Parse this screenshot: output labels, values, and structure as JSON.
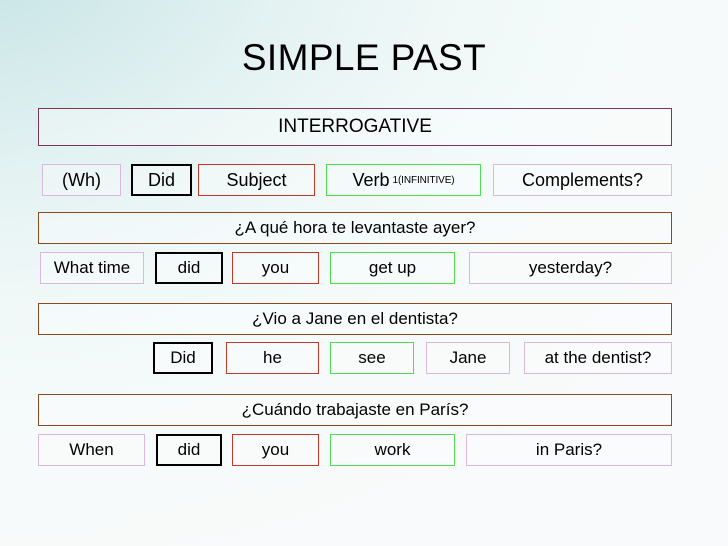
{
  "slide": {
    "title": "SIMPLE PAST",
    "section_label": "INTERROGATIVE",
    "background_accent": "#bfe0e2"
  },
  "colors": {
    "section_border": "#7a3558",
    "sentence_border": "#8a4a20",
    "wh_border": "#d9b8dd",
    "aux_border": "#000000",
    "subject_border": "#c0392b",
    "verb_border": "#4fdc4f",
    "complement_border": "#d9b8dd"
  },
  "headers": {
    "wh": "(Wh)",
    "aux": "Did",
    "subject": "Subject",
    "verb": "Verb",
    "verb_sub": "1(INFINITIVE)",
    "complements": "Complements?"
  },
  "examples": [
    {
      "spanish": "¿A qué hora te levantaste ayer?",
      "wh": "What time",
      "aux": "did",
      "subject": "you",
      "verb": "get up",
      "complements": "yesterday?"
    },
    {
      "spanish": "¿Vio a Jane en el dentista?",
      "wh": "",
      "aux": "Did",
      "subject": "he",
      "verb": "see",
      "object": "Jane",
      "complements": "at the dentist?"
    },
    {
      "spanish": "¿Cuándo trabajaste en París?",
      "wh": "When",
      "aux": "did",
      "subject": "you",
      "verb": "work",
      "complements": "in Paris?"
    }
  ]
}
